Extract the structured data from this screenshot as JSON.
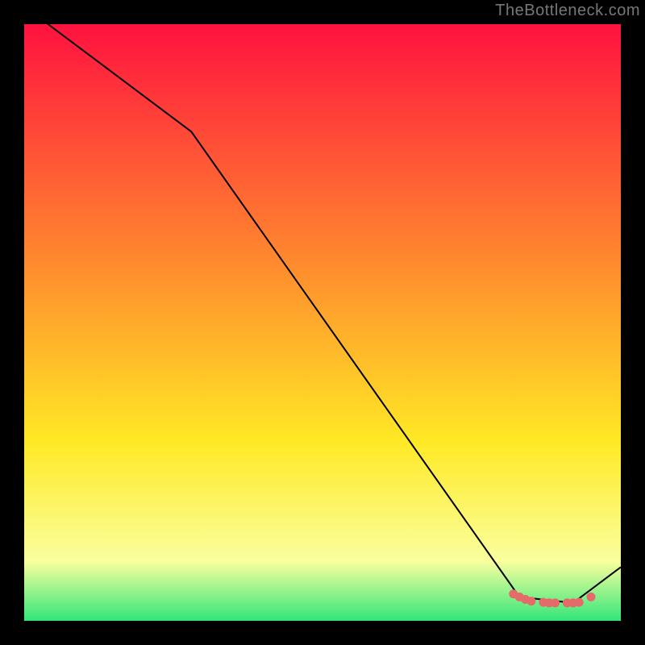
{
  "watermark": "TheBottleneck.com",
  "colors": {
    "background": "#000000",
    "gradient_top": "#ff123f",
    "gradient_mid_top": "#ff8a2e",
    "gradient_mid": "#ffe925",
    "gradient_mid_low": "#faff9e",
    "gradient_low": "#32e67a",
    "line": "#000000",
    "marker": "#e56b6b"
  },
  "chart_data": {
    "type": "line",
    "title": "",
    "xlabel": "",
    "ylabel": "",
    "xlim": [
      0,
      100
    ],
    "ylim": [
      0,
      100
    ],
    "series": [
      {
        "name": "curve",
        "x": [
          0,
          28,
          83,
          92,
          100
        ],
        "values": [
          103,
          82,
          4,
          3,
          9
        ]
      }
    ],
    "markers": {
      "name": "cluster",
      "points": [
        {
          "x": 82,
          "y": 4.5
        },
        {
          "x": 83,
          "y": 4.0
        },
        {
          "x": 84,
          "y": 3.6
        },
        {
          "x": 85,
          "y": 3.3
        },
        {
          "x": 87,
          "y": 3.1
        },
        {
          "x": 88,
          "y": 3.0
        },
        {
          "x": 89,
          "y": 3.0
        },
        {
          "x": 91,
          "y": 3.0
        },
        {
          "x": 92,
          "y": 3.0
        },
        {
          "x": 93,
          "y": 3.1
        },
        {
          "x": 95,
          "y": 4.0
        }
      ]
    }
  }
}
